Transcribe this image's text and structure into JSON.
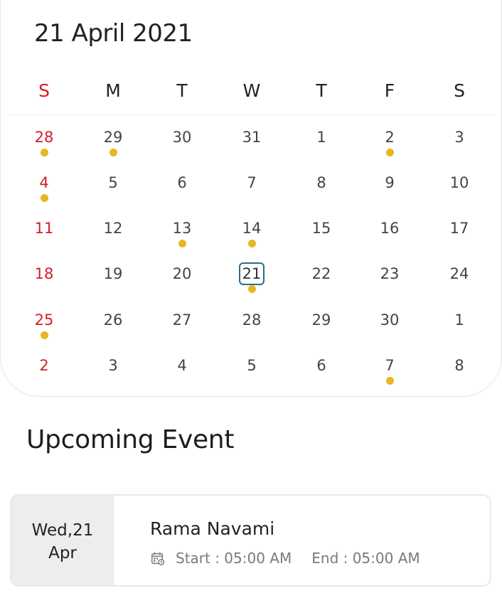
{
  "calendar": {
    "title": "21 April 2021",
    "weekdays": [
      "S",
      "M",
      "T",
      "W",
      "T",
      "F",
      "S"
    ],
    "weeks": [
      [
        {
          "d": "28",
          "dot": true
        },
        {
          "d": "29",
          "dot": true
        },
        {
          "d": "30",
          "dot": false
        },
        {
          "d": "31",
          "dot": false
        },
        {
          "d": "1",
          "dot": false
        },
        {
          "d": "2",
          "dot": true
        },
        {
          "d": "3",
          "dot": false
        }
      ],
      [
        {
          "d": "4",
          "dot": true
        },
        {
          "d": "5",
          "dot": false
        },
        {
          "d": "6",
          "dot": false
        },
        {
          "d": "7",
          "dot": false
        },
        {
          "d": "8",
          "dot": false
        },
        {
          "d": "9",
          "dot": false
        },
        {
          "d": "10",
          "dot": false
        }
      ],
      [
        {
          "d": "11",
          "dot": false
        },
        {
          "d": "12",
          "dot": false
        },
        {
          "d": "13",
          "dot": true
        },
        {
          "d": "14",
          "dot": true
        },
        {
          "d": "15",
          "dot": false
        },
        {
          "d": "16",
          "dot": false
        },
        {
          "d": "17",
          "dot": false
        }
      ],
      [
        {
          "d": "18",
          "dot": false
        },
        {
          "d": "19",
          "dot": false
        },
        {
          "d": "20",
          "dot": false
        },
        {
          "d": "21",
          "dot": true,
          "today": true
        },
        {
          "d": "22",
          "dot": false
        },
        {
          "d": "23",
          "dot": false
        },
        {
          "d": "24",
          "dot": false
        }
      ],
      [
        {
          "d": "25",
          "dot": true
        },
        {
          "d": "26",
          "dot": false
        },
        {
          "d": "27",
          "dot": false
        },
        {
          "d": "28",
          "dot": false
        },
        {
          "d": "29",
          "dot": false
        },
        {
          "d": "30",
          "dot": false
        },
        {
          "d": "1",
          "dot": false
        }
      ],
      [
        {
          "d": "2",
          "dot": false
        },
        {
          "d": "3",
          "dot": false
        },
        {
          "d": "4",
          "dot": false
        },
        {
          "d": "5",
          "dot": false
        },
        {
          "d": "6",
          "dot": false
        },
        {
          "d": "7",
          "dot": true
        },
        {
          "d": "8",
          "dot": false
        }
      ]
    ]
  },
  "upcoming": {
    "title": "Upcoming Event",
    "event": {
      "date_line1": "Wed,21",
      "date_line2": "Apr",
      "name": "Rama Navami",
      "start": "Start : 05:00 AM",
      "end": "End : 05:00 AM",
      "icon": "calendar-clock-icon"
    }
  },
  "colors": {
    "sunday": "#d31f2a",
    "event_dot": "#e8b620",
    "today_border": "#2d6b8a",
    "date_box_bg": "#ededed"
  }
}
